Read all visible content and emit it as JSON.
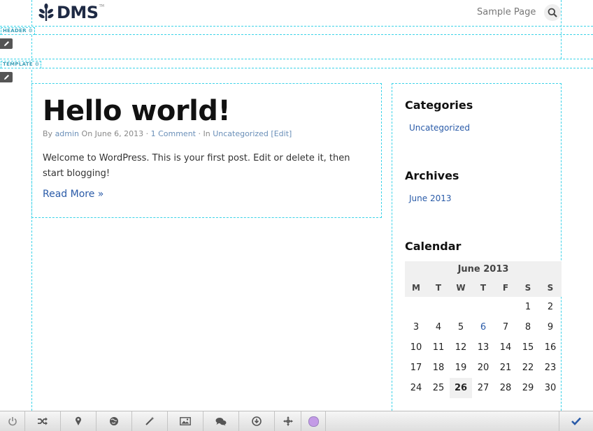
{
  "header": {
    "logo_text": "DMS",
    "logo_tm": "TM",
    "nav_link": "Sample Page",
    "search_icon": "search-icon"
  },
  "areas": {
    "header_tag": "HEADER",
    "template_tag": "TEMPLATE"
  },
  "post": {
    "title": "Hello world!",
    "meta_by": "By",
    "author": "admin",
    "meta_on": "On June 6, 2013 ·",
    "comments": "1 Comment",
    "meta_in": "· In",
    "category": "Uncategorized",
    "edit": "[Edit]",
    "excerpt": "Welcome to WordPress. This is your first post. Edit or delete it, then start blogging!",
    "read_more": "Read More »"
  },
  "sidebar": {
    "categories_title": "Categories",
    "categories": [
      "Uncategorized"
    ],
    "archives_title": "Archives",
    "archives": [
      "June 2013"
    ],
    "calendar_title": "Calendar"
  },
  "calendar": {
    "caption": "June 2013",
    "weekdays": [
      "M",
      "T",
      "W",
      "T",
      "F",
      "S",
      "S"
    ],
    "weeks": [
      [
        "",
        "",
        "",
        "",
        "",
        "1",
        "2"
      ],
      [
        "3",
        "4",
        "5",
        "6",
        "7",
        "8",
        "9"
      ],
      [
        "10",
        "11",
        "12",
        "13",
        "14",
        "15",
        "16"
      ],
      [
        "17",
        "18",
        "19",
        "20",
        "21",
        "22",
        "23"
      ],
      [
        "24",
        "25",
        "26",
        "27",
        "28",
        "29",
        "30"
      ]
    ],
    "linked_day": "6",
    "today": "26"
  },
  "toolbar": {
    "items": [
      "power-icon",
      "shuffle-icon",
      "map-pin-icon",
      "globe-icon",
      "magic-wand-icon",
      "image-icon",
      "comments-icon",
      "download-icon",
      "move-icon",
      "color-swatch-icon"
    ],
    "swatch_color": "#c39be6",
    "check_icon": "check-icon"
  },
  "colors": {
    "guide_dash": "#3cd3e8",
    "link": "#2a5ba8",
    "logo": "#1e2a44"
  }
}
